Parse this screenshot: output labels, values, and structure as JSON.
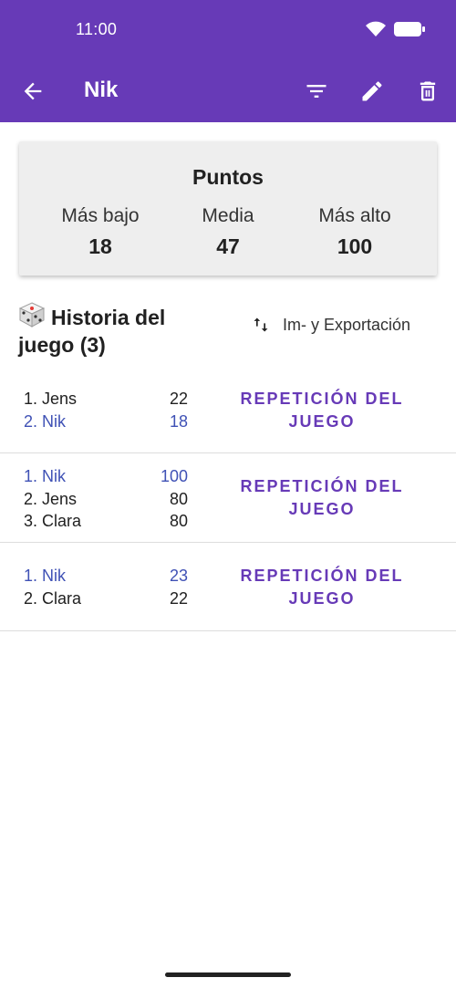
{
  "status_bar": {
    "time": "11:00"
  },
  "toolbar": {
    "title": "Nik"
  },
  "stats": {
    "title": "Puntos",
    "lowest_label": "Más bajo",
    "lowest_value": "18",
    "average_label": "Media",
    "average_value": "47",
    "highest_label": "Más alto",
    "highest_value": "100"
  },
  "history": {
    "title_line1": "Historia del",
    "title_line2": "juego (3)",
    "import_export_label": "Im- y Exportación"
  },
  "games": [
    {
      "replay_line1": "REPETICIÓN DEL",
      "replay_line2": "JUEGO",
      "entries": [
        {
          "name": "1. Jens",
          "score": "22"
        },
        {
          "name": "2. Nik",
          "score": "18"
        }
      ]
    },
    {
      "replay_line1": "REPETICIÓN DEL",
      "replay_line2": "JUEGO",
      "entries": [
        {
          "name": "1. Nik",
          "score": "100"
        },
        {
          "name": "2. Jens",
          "score": "80"
        },
        {
          "name": "3. Clara",
          "score": "80"
        }
      ]
    },
    {
      "replay_line1": "REPETICIÓN DEL",
      "replay_line2": "JUEGO",
      "entries": [
        {
          "name": "1. Nik",
          "score": "23"
        },
        {
          "name": "2. Clara",
          "score": "22"
        }
      ]
    }
  ],
  "colors": {
    "primary": "#673ab7",
    "highlight_player": "#3f51b5",
    "card_bg": "#eeeeee"
  }
}
